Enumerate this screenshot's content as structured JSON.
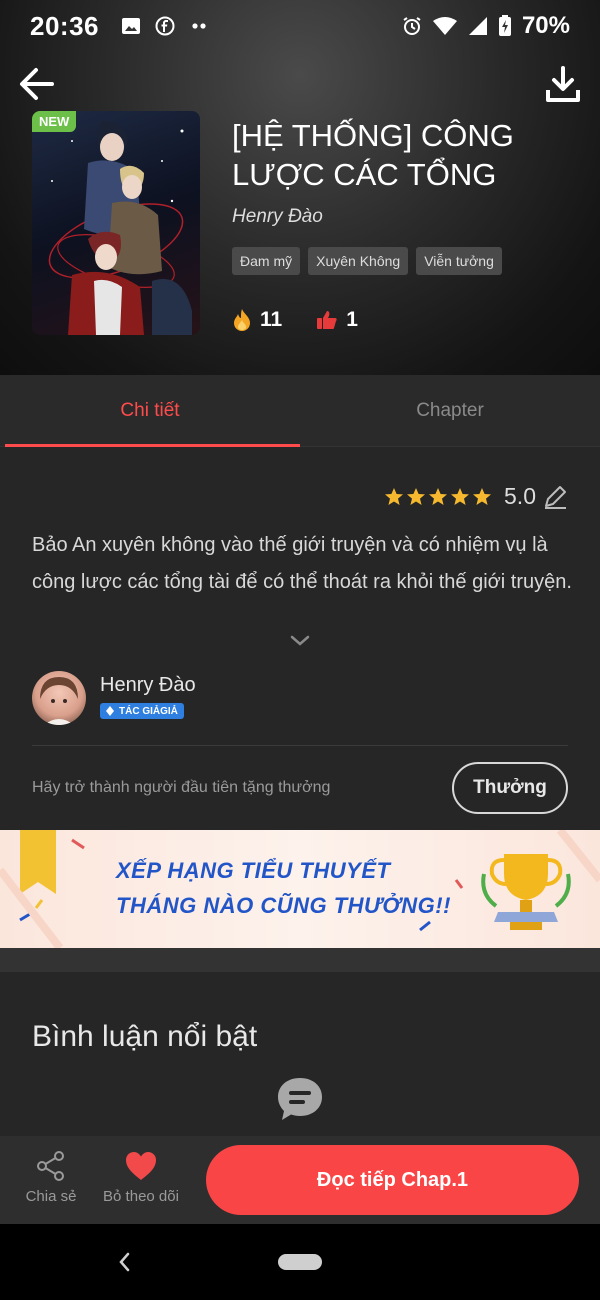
{
  "status_bar": {
    "time": "20:36",
    "battery": "70%"
  },
  "story": {
    "badge": "NEW",
    "title": "[HỆ THỐNG] CÔNG LƯỢC CÁC TỔNG",
    "author": "Henry Đào",
    "tags": [
      "Đam mỹ",
      "Xuyên Không",
      "Viễn tưởng"
    ],
    "views": "11",
    "likes": "1"
  },
  "tabs": [
    {
      "label": "Chi tiết",
      "active": true
    },
    {
      "label": "Chapter",
      "active": false
    }
  ],
  "detail": {
    "rating": "5.0",
    "stars": 5,
    "description": "Bảo An xuyên không vào thế giới truyện và có nhiệm vụ là công lược các tổng tài để có thể thoát ra khỏi thế giới truyện.",
    "author_name": "Henry Đào",
    "author_badge": "TÁC GIẢGIẢ",
    "gift_text": "Hãy trở thành người đầu tiên tặng thưởng",
    "gift_button": "Thưởng"
  },
  "banner": {
    "line1": "XẾP HẠNG TIỂU THUYẾT",
    "line2": "THÁNG NÀO CŨNG THƯỞNG!!"
  },
  "comments": {
    "title": "Bình luận nổi bật"
  },
  "bottom_bar": {
    "share_label": "Chia sẻ",
    "follow_label": "Bỏ theo dõi",
    "read_button": "Đọc tiếp Chap.1"
  },
  "colors": {
    "accent": "#f94545",
    "tab_active": "#ff4b4b",
    "badge_new": "#6cc04a",
    "banner_text": "#2256c8"
  }
}
